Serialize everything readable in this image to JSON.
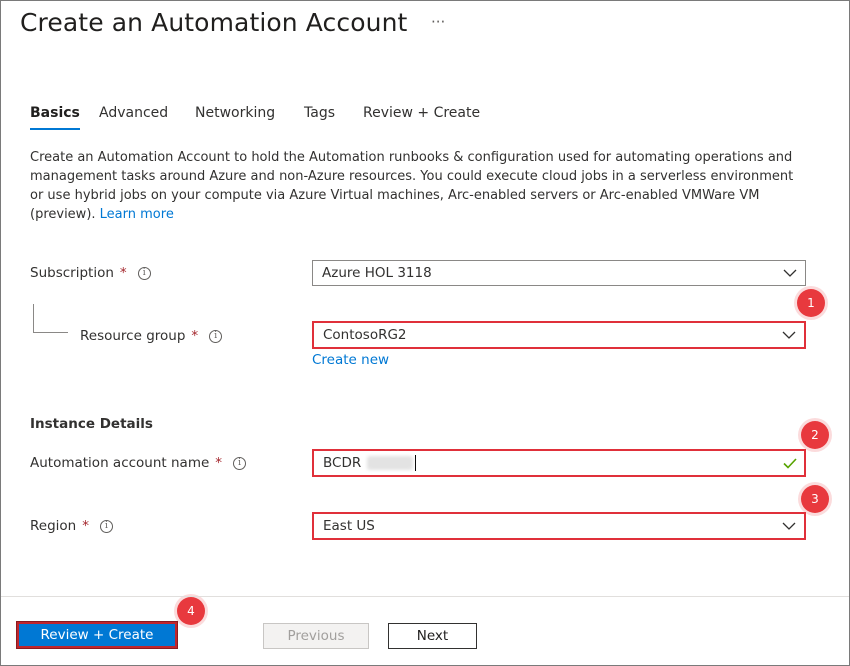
{
  "page": {
    "title": "Create an Automation Account",
    "more_label": "···"
  },
  "tabs": [
    {
      "label": "Basics",
      "active": true
    },
    {
      "label": "Advanced",
      "active": false
    },
    {
      "label": "Networking",
      "active": false
    },
    {
      "label": "Tags",
      "active": false
    },
    {
      "label": "Review + Create",
      "active": false
    }
  ],
  "description": {
    "text": "Create an Automation Account to hold the Automation runbooks & configuration used for automating operations and management tasks around Azure and non-Azure resources. You could execute cloud jobs in a serverless environment or use hybrid jobs on your compute via Azure Virtual machines, Arc-enabled servers or Arc-enabled VMWare VM (preview).",
    "learn_more": "Learn more"
  },
  "form": {
    "subscription": {
      "label": "Subscription",
      "required": "*",
      "value": "Azure HOL 3118"
    },
    "resource_group": {
      "label": "Resource group",
      "required": "*",
      "value": "ContosoRG2",
      "create_new": "Create new"
    },
    "instance_section": "Instance Details",
    "account_name": {
      "label": "Automation account name",
      "required": "*",
      "value": "BCDR"
    },
    "region": {
      "label": "Region",
      "required": "*",
      "value": "East US"
    }
  },
  "callouts": [
    "1",
    "2",
    "3",
    "4"
  ],
  "footer": {
    "review_create": "Review + Create",
    "previous": "Previous",
    "next": "Next"
  },
  "colors": {
    "accent": "#0078d4",
    "highlight": "#e0303a",
    "valid": "#57a300"
  },
  "icons": [
    "info-icon",
    "chevron-down-icon",
    "checkmark-icon",
    "more-icon"
  ]
}
